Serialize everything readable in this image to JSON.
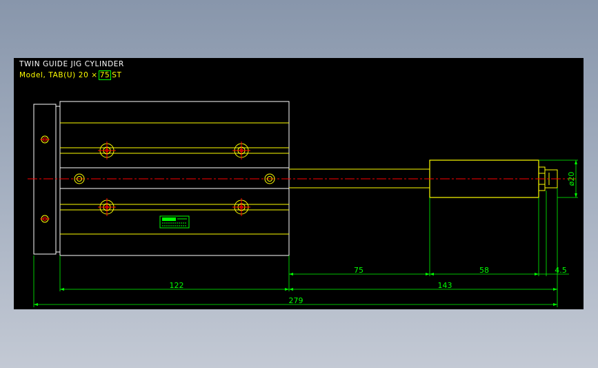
{
  "title": "TWIN GUIDE JIG CYLINDER",
  "model": {
    "prefix": "Model, TAB(U) 20 ×",
    "stroke": "75",
    "suffix": "ST"
  },
  "dimensions": {
    "rod_length": "75",
    "end_length": "58",
    "nut_length": "4.5",
    "body_length": "122",
    "extension_length": "143",
    "overall_length": "279",
    "rod_diameter": "ø20"
  },
  "colors": {
    "background": "#000000",
    "outline": "#ffffff",
    "inner_lines": "#ffff00",
    "dimension": "#00ff00",
    "centerline": "#ff0000",
    "title": "#ffffff",
    "model_text": "#ffff00"
  }
}
